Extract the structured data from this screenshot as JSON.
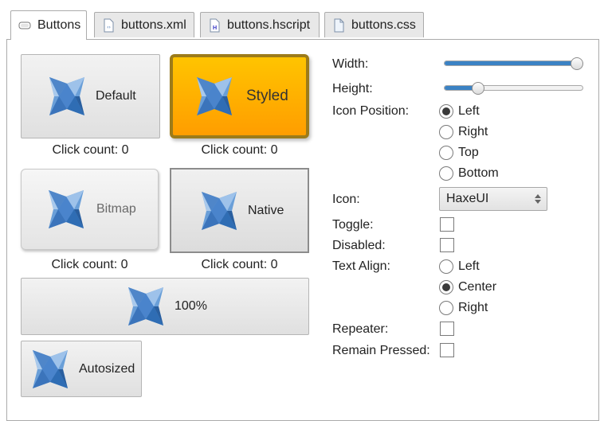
{
  "tabs": [
    {
      "label": "Buttons",
      "icon": "button-icon",
      "active": true
    },
    {
      "label": "buttons.xml",
      "icon": "xml-file-icon",
      "active": false
    },
    {
      "label": "buttons.hscript",
      "icon": "hscript-file-icon",
      "active": false
    },
    {
      "label": "buttons.css",
      "icon": "css-file-icon",
      "active": false
    }
  ],
  "buttons": {
    "default": {
      "label": "Default",
      "count": "Click count: 0"
    },
    "styled": {
      "label": "Styled",
      "count": "Click count: 0"
    },
    "bitmap": {
      "label": "Bitmap",
      "count": "Click count: 0"
    },
    "native": {
      "label": "Native",
      "count": "Click count: 0"
    },
    "percent": {
      "label": "100%"
    },
    "autosized": {
      "label": "Autosized"
    }
  },
  "settings": {
    "width": {
      "label": "Width:",
      "value_fraction": 1.0
    },
    "height": {
      "label": "Height:",
      "value_fraction": 0.22
    },
    "icon_position": {
      "label": "Icon Position:",
      "options": [
        "Left",
        "Right",
        "Top",
        "Bottom"
      ],
      "selected": "Left"
    },
    "icon": {
      "label": "Icon:",
      "value": "HaxeUI"
    },
    "toggle": {
      "label": "Toggle:",
      "checked": false
    },
    "disabled": {
      "label": "Disabled:",
      "checked": false
    },
    "text_align": {
      "label": "Text Align:",
      "options": [
        "Left",
        "Center",
        "Right"
      ],
      "selected": "Center"
    },
    "repeater": {
      "label": "Repeater:",
      "checked": false
    },
    "remain_pressed": {
      "label": "Remain Pressed:",
      "checked": false
    }
  },
  "colors": {
    "accent": "#3b82c4",
    "styled_button": "#ffb000",
    "styled_border": "#9c7b1a",
    "logo_light": "#8fb7e3",
    "logo_dark": "#2f6db4"
  }
}
